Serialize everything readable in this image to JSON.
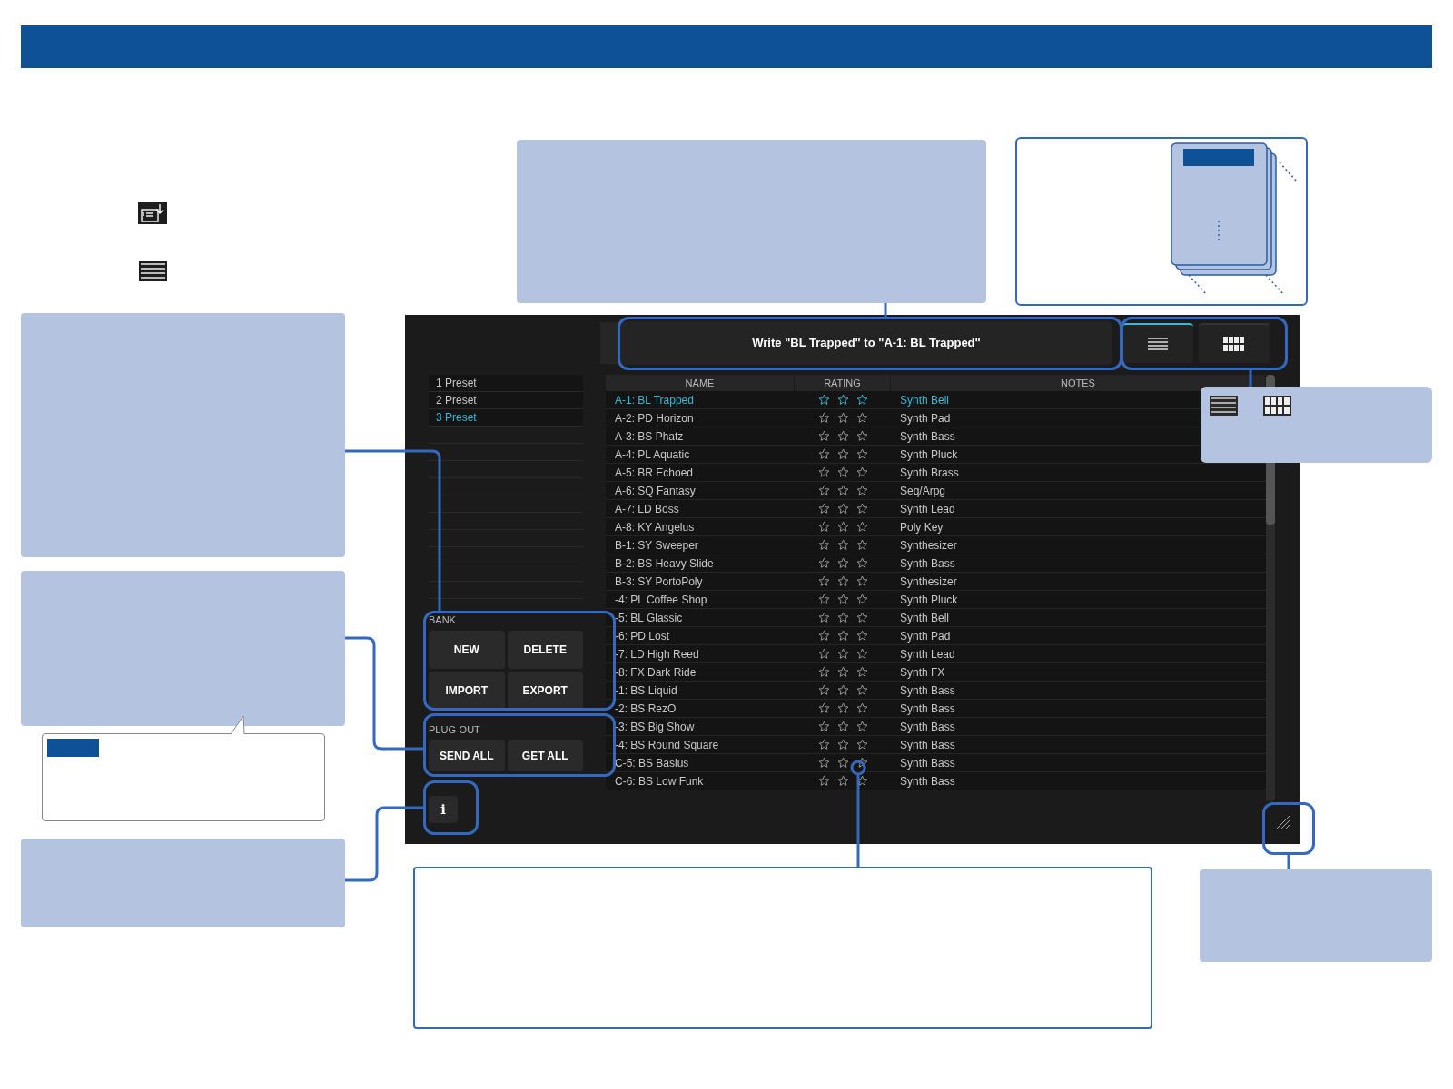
{
  "write_button": {
    "label": "Write \"BL Trapped\" to \"A-1: BL Trapped\""
  },
  "view_toggle": [
    {
      "kind": "list",
      "selected": true
    },
    {
      "kind": "grid",
      "selected": false
    }
  ],
  "presets": [
    {
      "label": "1 Preset",
      "selected": false
    },
    {
      "label": "2 Preset",
      "selected": false
    },
    {
      "label": "3 Preset",
      "selected": true
    }
  ],
  "table": {
    "columns": [
      "NAME",
      "RATING",
      "NOTES"
    ],
    "rows": [
      {
        "name": "A-1: BL Trapped",
        "stars": 0,
        "notes": "Synth Bell",
        "selected": true
      },
      {
        "name": "A-2: PD Horizon",
        "stars": 0,
        "notes": "Synth Pad",
        "selected": false
      },
      {
        "name": "A-3: BS Phatz",
        "stars": 0,
        "notes": "Synth Bass",
        "selected": false
      },
      {
        "name": "A-4: PL Aquatic",
        "stars": 0,
        "notes": "Synth Pluck",
        "selected": false
      },
      {
        "name": "A-5: BR Echoed",
        "stars": 0,
        "notes": "Synth Brass",
        "selected": false
      },
      {
        "name": "A-6: SQ Fantasy",
        "stars": 0,
        "notes": "Seq/Arpg",
        "selected": false
      },
      {
        "name": "A-7: LD Boss",
        "stars": 0,
        "notes": "Synth Lead",
        "selected": false
      },
      {
        "name": "A-8: KY Angelus",
        "stars": 0,
        "notes": "Poly Key",
        "selected": false
      },
      {
        "name": "B-1: SY Sweeper",
        "stars": 0,
        "notes": "Synthesizer",
        "selected": false
      },
      {
        "name": "B-2: BS Heavy Slide",
        "stars": 0,
        "notes": "Synth Bass",
        "selected": false
      },
      {
        "name": "B-3: SY PortoPoly",
        "stars": 0,
        "notes": "Synthesizer",
        "selected": false
      },
      {
        "name": "-4: PL Coffee Shop",
        "stars": 0,
        "notes": "Synth Pluck",
        "selected": false
      },
      {
        "name": "-5: BL Glassic",
        "stars": 0,
        "notes": "Synth Bell",
        "selected": false
      },
      {
        "name": "-6: PD Lost",
        "stars": 0,
        "notes": "Synth Pad",
        "selected": false
      },
      {
        "name": "-7: LD High Reed",
        "stars": 0,
        "notes": "Synth Lead",
        "selected": false
      },
      {
        "name": "-8: FX Dark Ride",
        "stars": 0,
        "notes": "Synth FX",
        "selected": false
      },
      {
        "name": "-1: BS Liquid",
        "stars": 0,
        "notes": "Synth Bass",
        "selected": false
      },
      {
        "name": "-2: BS RezO",
        "stars": 0,
        "notes": "Synth Bass",
        "selected": false
      },
      {
        "name": "-3: BS Big Show",
        "stars": 0,
        "notes": "Synth Bass",
        "selected": false
      },
      {
        "name": "-4: BS Round Square",
        "stars": 0,
        "notes": "Synth Bass",
        "selected": false
      },
      {
        "name": "C-5: BS Basius",
        "stars": 0,
        "notes": "Synth Bass",
        "selected": false
      },
      {
        "name": "C-6: BS Low Funk",
        "stars": 0,
        "notes": "Synth Bass",
        "selected": false
      }
    ]
  },
  "bank": {
    "label": "BANK",
    "buttons": [
      "NEW",
      "DELETE",
      "IMPORT",
      "EXPORT"
    ]
  },
  "plug_out": {
    "label": "PLUG-OUT",
    "buttons": [
      "SEND ALL",
      "GET ALL"
    ]
  },
  "info_button": {
    "label": "i"
  }
}
